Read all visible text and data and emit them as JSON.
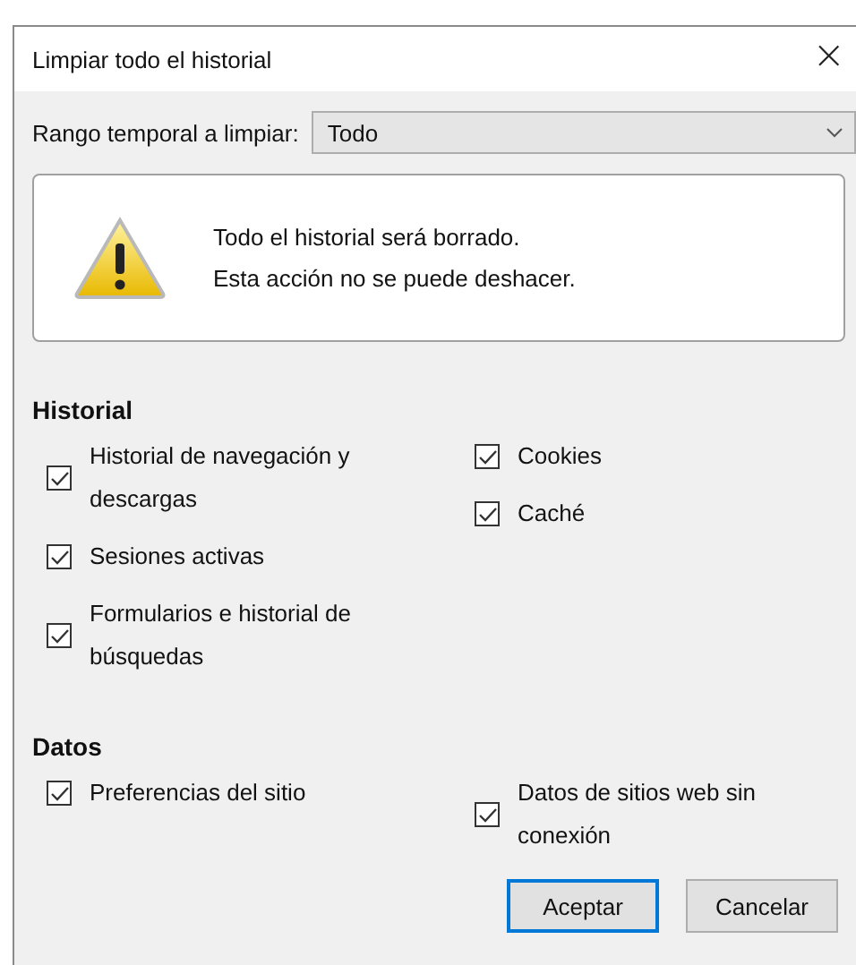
{
  "window": {
    "title": "Limpiar todo el historial",
    "close": "×"
  },
  "time_range": {
    "label": "Rango temporal a limpiar:",
    "value": "Todo"
  },
  "warning": {
    "lines": [
      "Todo el historial será borrado.",
      "Esta acción no se puede deshacer."
    ]
  },
  "sections": [
    {
      "title": "Historial",
      "left": [
        {
          "label": "Historial de navegación y descargas",
          "checked": true
        },
        {
          "label": "Sesiones activas",
          "checked": true
        },
        {
          "label": "Formularios e historial de búsquedas",
          "checked": true
        }
      ],
      "right": [
        {
          "label": "Cookies",
          "checked": true
        },
        {
          "label": "Caché",
          "checked": true
        }
      ]
    },
    {
      "title": "Datos",
      "left": [
        {
          "label": "Preferencias del sitio",
          "checked": true
        }
      ],
      "right": [
        {
          "label": "Datos de sitios web sin conexión",
          "checked": true
        }
      ]
    }
  ],
  "buttons": [
    {
      "label": "Aceptar",
      "default": true
    },
    {
      "label": "Cancelar",
      "default": false
    }
  ]
}
